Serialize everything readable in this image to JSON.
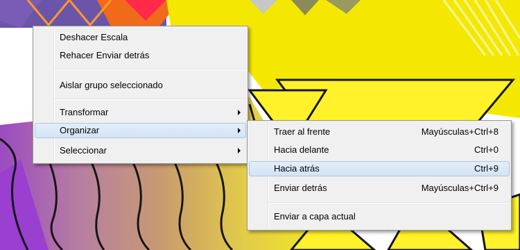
{
  "background": {
    "description_icon": "abstract-colorful-artwork",
    "colors": {
      "yellow": "#f5e800",
      "violet": "#8d3fc0",
      "outline": "#151515"
    }
  },
  "context_menu": {
    "items": [
      {
        "label": "Deshacer Escala"
      },
      {
        "label": "Rehacer Enviar detrás"
      },
      {
        "label": "Aislar grupo seleccionado"
      },
      {
        "label": "Transformar",
        "submenu_icon": "chevron-right-icon"
      },
      {
        "label": "Organizar",
        "submenu_icon": "chevron-right-icon",
        "highlighted": true
      },
      {
        "label": "Seleccionar",
        "submenu_icon": "chevron-right-icon"
      }
    ]
  },
  "submenu": {
    "items": [
      {
        "label": "Traer al frente",
        "shortcut": "Mayúsculas+Ctrl+8"
      },
      {
        "label": "Hacia delante",
        "shortcut": "Ctrl+0"
      },
      {
        "label": "Hacia atrás",
        "shortcut": "Ctrl+9",
        "highlighted": true
      },
      {
        "label": "Enviar detrás",
        "shortcut": "Mayúsculas+Ctrl+9"
      },
      {
        "label": "Enviar a capa actual",
        "shortcut": ""
      }
    ]
  },
  "theme": {
    "menu_bg": "#f0f0f0",
    "menu_border": "#979797",
    "highlight_bg": "#d9e7f7",
    "highlight_border": "#a8c7e6"
  }
}
